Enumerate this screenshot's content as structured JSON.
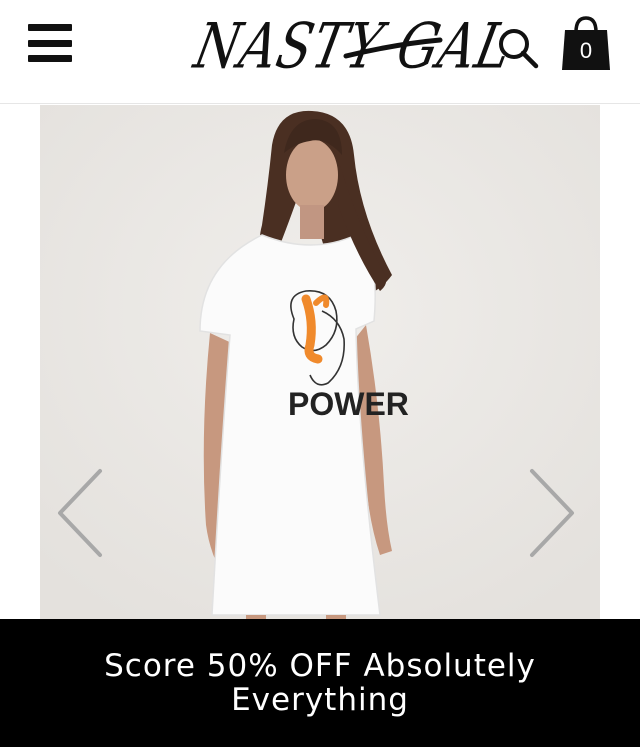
{
  "header": {
    "logo_text": "NASTY GAL",
    "menu_icon": "hamburger-menu-icon",
    "search_icon": "search-icon",
    "bag_icon": "shopping-bag-icon",
    "bag_count": "0"
  },
  "product_image": {
    "print_text": "POWER",
    "colors": {
      "tee": "#ffffff",
      "accent": "#f08a2c",
      "backdrop": "#ebe9e6"
    }
  },
  "gallery": {
    "prev_icon": "chevron-left-icon",
    "next_icon": "chevron-right-icon"
  },
  "promo": {
    "text": "Score 50% OFF Absolutely Everything",
    "background": "#000000",
    "color": "#ffffff"
  }
}
